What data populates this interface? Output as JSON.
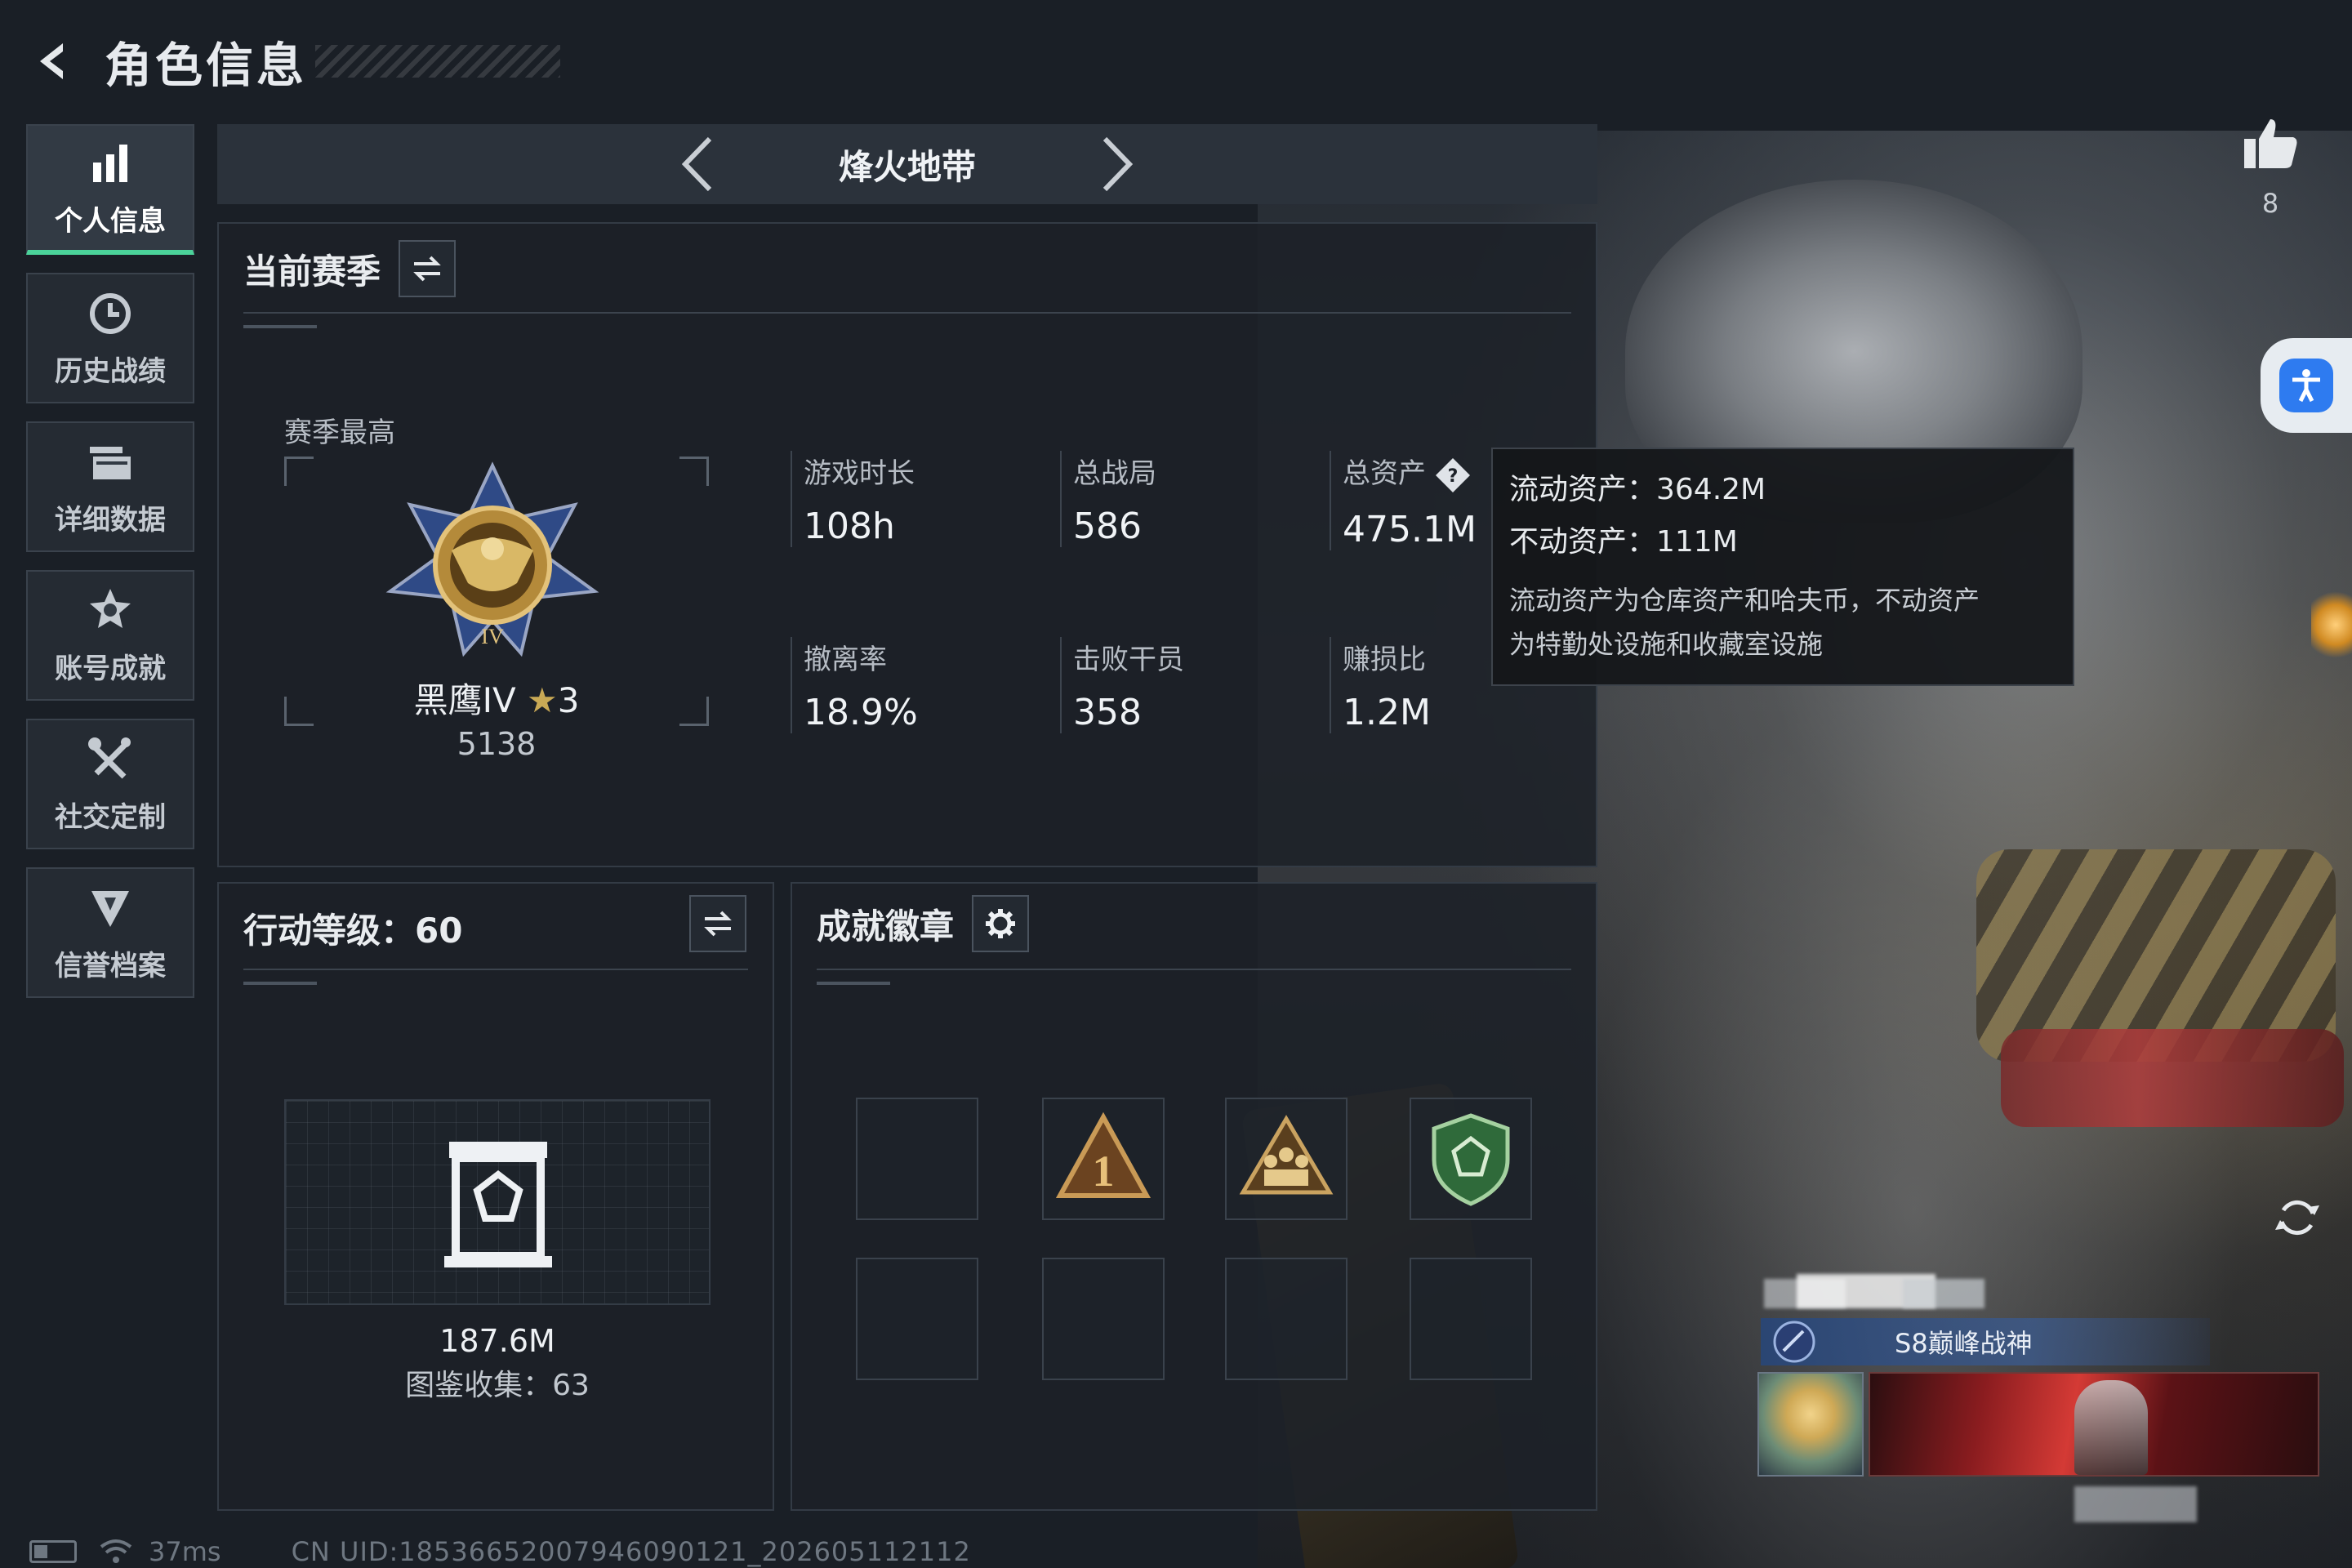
{
  "page": {
    "title": "角色信息"
  },
  "sidebar": {
    "items": [
      {
        "label": "个人信息",
        "icon": "bar-chart-icon",
        "active": true
      },
      {
        "label": "历史战绩",
        "icon": "history-clock-icon",
        "active": false
      },
      {
        "label": "详细数据",
        "icon": "folder-stack-icon",
        "active": false
      },
      {
        "label": "账号成就",
        "icon": "achievement-star-icon",
        "active": false
      },
      {
        "label": "社交定制",
        "icon": "tools-cross-icon",
        "active": false
      },
      {
        "label": "信誉档案",
        "icon": "credit-shield-icon",
        "active": false
      }
    ]
  },
  "mode": {
    "current": "烽火地带"
  },
  "season": {
    "title": "当前赛季",
    "best_label": "赛季最高",
    "rank_name": "黑鹰IV",
    "rank_stars": "3",
    "rank_score": "5138",
    "stats": [
      {
        "label": "游戏时长",
        "value": "108h"
      },
      {
        "label": "总战局",
        "value": "586"
      },
      {
        "label": "总资产",
        "value": "475.1M"
      },
      {
        "label": "撤离率",
        "value": "18.9%"
      },
      {
        "label": "击败干员",
        "value": "358"
      },
      {
        "label": "赚损比",
        "value": "1.2M"
      }
    ]
  },
  "tooltip": {
    "liquid": "流动资产：364.2M",
    "fixed": "不动资产：111M",
    "note_line1": "流动资产为仓库资产和哈夫币，不动资产",
    "note_line2": "为特勤处设施和收藏室设施"
  },
  "action_level": {
    "title": "行动等级：60",
    "collection_value": "187.6M",
    "collection_count": "图鉴收集：63"
  },
  "achievements": {
    "title": "成就徽章",
    "slots_row1": [
      "empty",
      "rank-one-badge-icon",
      "squad-badge-icon",
      "green-shield-badge-icon"
    ],
    "slots_row2": [
      "empty",
      "empty",
      "empty",
      "empty"
    ]
  },
  "profile": {
    "likes": "8",
    "title_tag": "S8巅峰战神"
  },
  "footer": {
    "ping": "37ms",
    "uid": "CN UID:18536652007946090121_202605112112"
  },
  "colors": {
    "accent_green": "#4bd39a",
    "panel_bg": "#1c2128",
    "access_blue": "#2e7bf0"
  }
}
